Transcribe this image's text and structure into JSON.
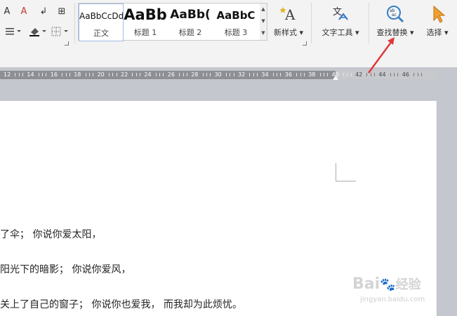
{
  "toolbar": {
    "format_buttons": [
      "A",
      "A",
      "↲",
      "⊞"
    ],
    "styles": [
      {
        "sample": "AaBbCcDd",
        "label": "正文"
      },
      {
        "sample": "AaBb",
        "label": "标题 1"
      },
      {
        "sample": "AaBb(",
        "label": "标题 2"
      },
      {
        "sample": "AaBbC",
        "label": "标题 3"
      }
    ],
    "new_style_label": "新样式",
    "text_tools_label": "文字工具",
    "find_replace_label": "查找替换",
    "select_label": "选择"
  },
  "ruler": {
    "numbers": [
      "12",
      "14",
      "16",
      "18",
      "20",
      "22",
      "24",
      "26",
      "28",
      "30",
      "32",
      "34",
      "36",
      "38",
      "40",
      "42",
      "44",
      "46"
    ]
  },
  "document": {
    "lines": [
      "了伞； 你说你爱太阳，",
      "阳光下的暗影； 你说你爱风，",
      "关上了自己的窗子； 你说你也爱我， 而我却为此烦忧。"
    ]
  },
  "watermark": {
    "brand": "Bai",
    "brand2": "经验",
    "url": "jingyan.baidu.com"
  },
  "colors": {
    "arrow": "#e03838",
    "ruler_dark": "#8e8f94",
    "style_selected_border": "#9fbbe4"
  }
}
